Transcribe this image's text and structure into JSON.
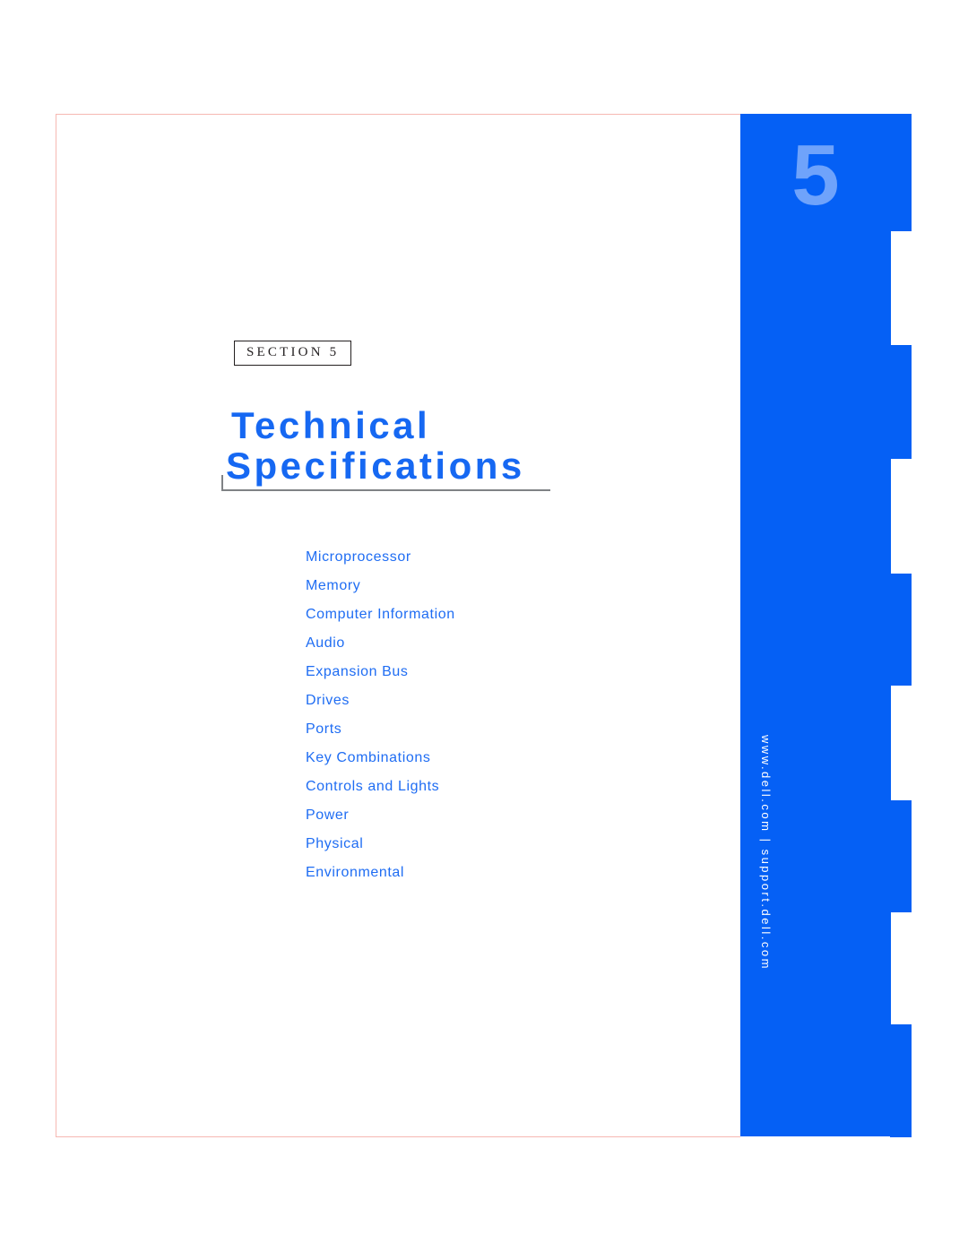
{
  "page": {
    "section_number": "5",
    "section_label": "SECTION 5",
    "title_line1": "Technical",
    "title_line2": "Specifications",
    "vertical_url": "www.dell.com | support.dell.com",
    "accent_blue": "#0560f5",
    "number_blue": "#6fa3fb",
    "title_blue": "#1668f2",
    "toc_blue": "#1f6df3",
    "rule_color": "#f6b8b2"
  },
  "toc": {
    "items": [
      {
        "label": "Microprocessor"
      },
      {
        "label": "Memory"
      },
      {
        "label": "Computer Information"
      },
      {
        "label": "Audio"
      },
      {
        "label": "Expansion Bus"
      },
      {
        "label": "Drives"
      },
      {
        "label": "Ports"
      },
      {
        "label": "Key Combinations"
      },
      {
        "label": "Controls and Lights"
      },
      {
        "label": "Power"
      },
      {
        "label": "Physical"
      },
      {
        "label": "Environmental"
      }
    ]
  }
}
